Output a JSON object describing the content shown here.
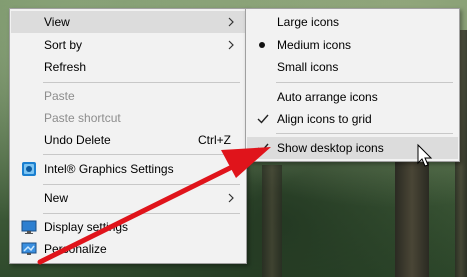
{
  "context_menu": {
    "items": [
      {
        "label": "View"
      },
      {
        "label": "Sort by"
      },
      {
        "label": "Refresh"
      },
      {
        "label": "Paste"
      },
      {
        "label": "Paste shortcut"
      },
      {
        "label": "Undo Delete",
        "shortcut": "Ctrl+Z"
      },
      {
        "label": "Intel® Graphics Settings"
      },
      {
        "label": "New"
      },
      {
        "label": "Display settings"
      },
      {
        "label": "Personalize"
      }
    ]
  },
  "view_submenu": {
    "items": [
      {
        "label": "Large icons"
      },
      {
        "label": "Medium icons",
        "selected": true
      },
      {
        "label": "Small icons"
      },
      {
        "label": "Auto arrange icons"
      },
      {
        "label": "Align icons to grid",
        "checked": true
      },
      {
        "label": "Show desktop icons",
        "checked": true
      }
    ]
  },
  "colors": {
    "menu_bg": "#f2f2f2",
    "highlight": "#dcdcdc",
    "disabled_text": "#8d8d8d",
    "arrow": "#e0141b"
  }
}
